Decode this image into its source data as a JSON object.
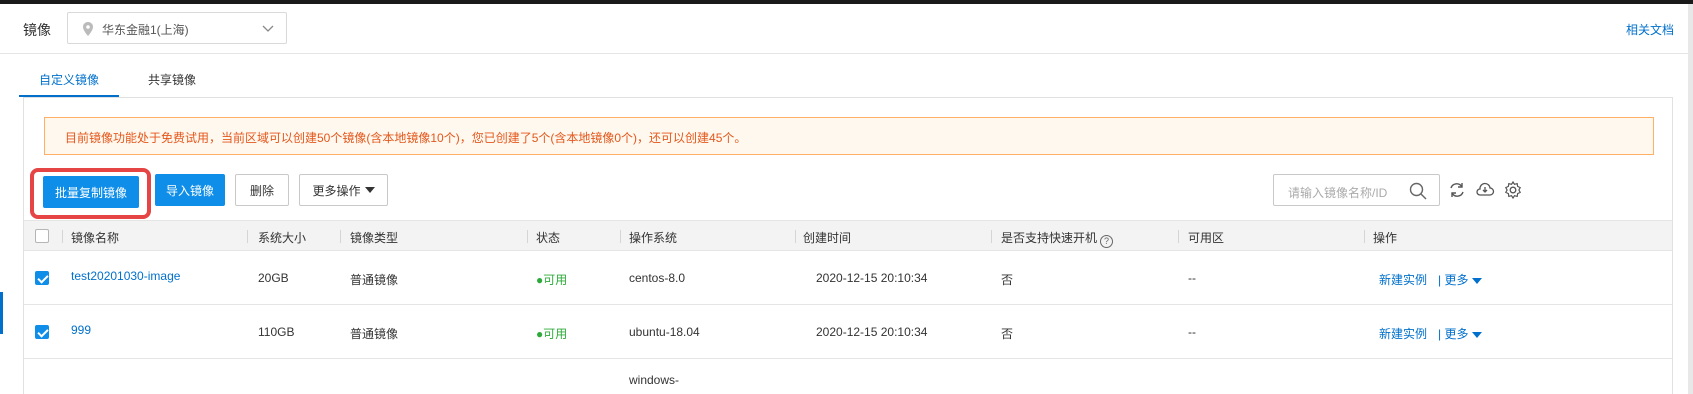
{
  "header": {
    "title": "镜像",
    "region_value": "华东金融1(上海)",
    "docs_link": "相关文档"
  },
  "tabs": [
    {
      "label": "自定义镜像",
      "active": true
    },
    {
      "label": "共享镜像",
      "active": false
    }
  ],
  "notice": "目前镜像功能处于免费试用，当前区域可以创建50个镜像(含本地镜像10个)，您已创建了5个(含本地镜像0个)，还可以创建45个。",
  "toolbar": {
    "batch_copy": "批量复制镜像",
    "import": "导入镜像",
    "delete": "删除",
    "more_ops": "更多操作",
    "search_placeholder": "请输入镜像名称/ID"
  },
  "table": {
    "columns": [
      "镜像名称",
      "系统大小",
      "镜像类型",
      "状态",
      "操作系统",
      "创建时间",
      "是否支持快速开机",
      "可用区",
      "操作"
    ],
    "help_icon_text": "?",
    "rows": [
      {
        "checked": true,
        "name": "test20201030-image",
        "size": "20GB",
        "type": "普通镜像",
        "status": "可用",
        "os": "centos-8.0",
        "created": "2020-12-15 20:10:34",
        "fast_boot": "否",
        "zone": "--",
        "action_new": "新建实例",
        "action_more": "| 更多"
      },
      {
        "checked": true,
        "name": "999",
        "size": "110GB",
        "type": "普通镜像",
        "status": "可用",
        "os": "ubuntu-18.04",
        "created": "2020-12-15 20:10:34",
        "fast_boot": "否",
        "zone": "--",
        "action_new": "新建实例",
        "action_more": "| 更多"
      },
      {
        "os_partial": "windows-"
      }
    ]
  },
  "colors": {
    "accent": "#0070cc",
    "primary_button": "#0e8ee9",
    "notice_text": "#e4571b",
    "notice_border": "#ffb066",
    "status_ok": "#2cab3a",
    "highlight": "#e54545"
  },
  "icons": [
    "location-pin-icon",
    "chevron-down-icon",
    "search-icon",
    "refresh-icon",
    "cloud-download-icon",
    "settings-icon"
  ]
}
